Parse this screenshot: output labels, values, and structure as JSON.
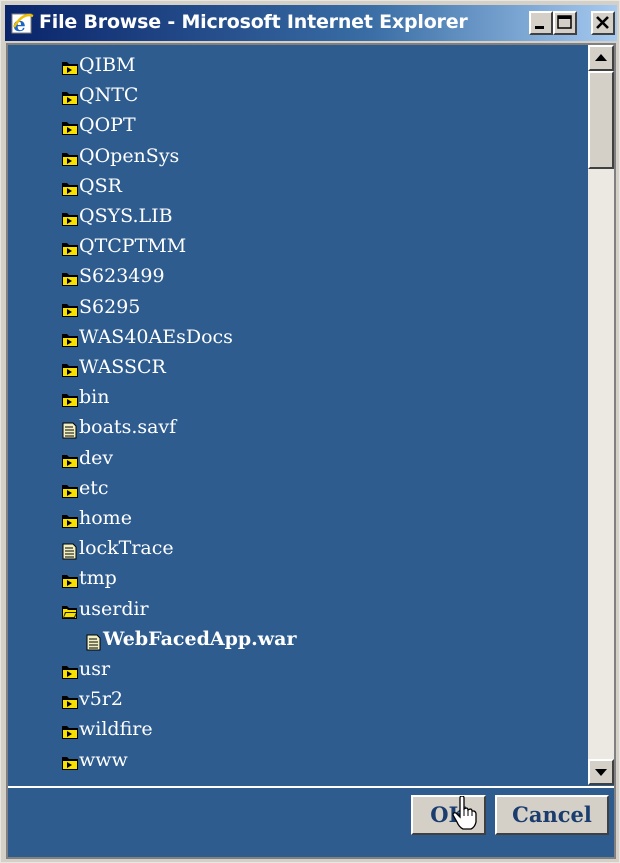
{
  "window": {
    "title": "File Browse - Microsoft Internet Explorer",
    "minimize_label": "_",
    "maximize_label": "□",
    "close_label": "×"
  },
  "tree": {
    "items": [
      {
        "type": "folder",
        "label": "QIBM"
      },
      {
        "type": "folder",
        "label": "QNTC"
      },
      {
        "type": "folder",
        "label": "QOPT"
      },
      {
        "type": "folder",
        "label": "QOpenSys"
      },
      {
        "type": "folder",
        "label": "QSR"
      },
      {
        "type": "folder",
        "label": "QSYS.LIB"
      },
      {
        "type": "folder",
        "label": "QTCPTMM"
      },
      {
        "type": "folder",
        "label": "S623499"
      },
      {
        "type": "folder",
        "label": "S6295"
      },
      {
        "type": "folder",
        "label": "WAS40AEsDocs"
      },
      {
        "type": "folder",
        "label": "WASSCR"
      },
      {
        "type": "folder",
        "label": "bin"
      },
      {
        "type": "file",
        "label": "boats.savf"
      },
      {
        "type": "folder",
        "label": "dev"
      },
      {
        "type": "folder",
        "label": "etc"
      },
      {
        "type": "folder",
        "label": "home"
      },
      {
        "type": "file",
        "label": "lockTrace"
      },
      {
        "type": "folder",
        "label": "tmp"
      },
      {
        "type": "folder-open",
        "label": "userdir"
      },
      {
        "type": "file",
        "label": "WebFacedApp.war",
        "selected": true,
        "indent": 1
      },
      {
        "type": "folder",
        "label": "usr"
      },
      {
        "type": "folder",
        "label": "v5r2"
      },
      {
        "type": "folder",
        "label": "wildfire"
      },
      {
        "type": "folder",
        "label": "www"
      }
    ]
  },
  "buttons": {
    "ok_label": "OK",
    "cancel_label": "Cancel"
  },
  "colors": {
    "panel_background": "#2e5c8f",
    "title_gradient_start": "#0a246a",
    "title_gradient_end": "#a6caf0",
    "folder_icon": "#f8e000",
    "button_text": "#1a3c6e"
  },
  "icons": {
    "title": "internet-explorer-icon",
    "folder": "folder-icon",
    "folder_open": "folder-open-icon",
    "file": "file-icon",
    "cursor": "hand-pointer-icon"
  }
}
